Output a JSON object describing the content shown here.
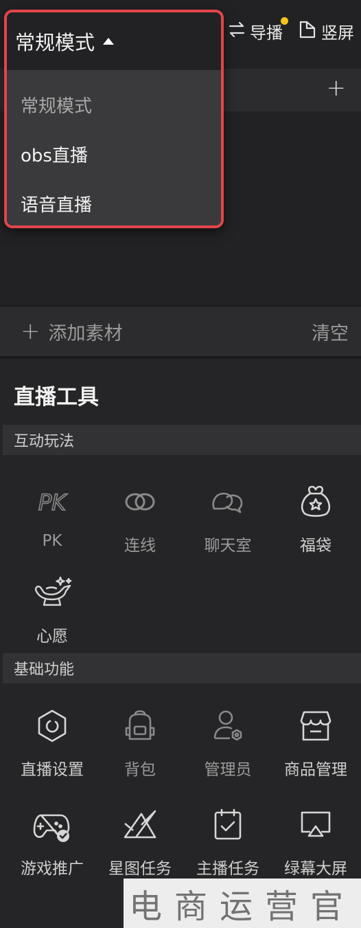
{
  "header": {
    "mode_current": "常规模式",
    "guide_label": "导播",
    "vertical_label": "竖屏"
  },
  "mode_dropdown": {
    "items": [
      "常规模式",
      "obs直播",
      "语音直播"
    ],
    "selected_index": 0
  },
  "material_bar": {
    "add_label": "添加素材",
    "clear_label": "清空"
  },
  "tools": {
    "title": "直播工具",
    "sections": [
      {
        "name": "互动玩法",
        "items": [
          {
            "label": "PK",
            "icon": "pk-icon"
          },
          {
            "label": "连线",
            "icon": "link-icon"
          },
          {
            "label": "聊天室",
            "icon": "chat-room-icon"
          },
          {
            "label": "福袋",
            "icon": "lucky-bag-icon"
          },
          {
            "label": "心愿",
            "icon": "wish-lamp-icon"
          }
        ]
      },
      {
        "name": "基础功能",
        "items": [
          {
            "label": "直播设置",
            "icon": "hexagon-settings-icon"
          },
          {
            "label": "背包",
            "icon": "backpack-icon"
          },
          {
            "label": "管理员",
            "icon": "admin-user-icon"
          },
          {
            "label": "商品管理",
            "icon": "store-icon"
          },
          {
            "label": "游戏推广",
            "icon": "gamepad-icon"
          },
          {
            "label": "星图任务",
            "icon": "star-map-icon"
          },
          {
            "label": "主播任务",
            "icon": "calendar-check-icon"
          },
          {
            "label": "绿幕大屏",
            "icon": "screen-cast-icon"
          }
        ]
      }
    ]
  },
  "watermark": {
    "text": "电商运营官"
  },
  "colors": {
    "highlight_border": "#e4444a",
    "notify_dot": "#f5c518",
    "panel_bg": "#252527"
  }
}
